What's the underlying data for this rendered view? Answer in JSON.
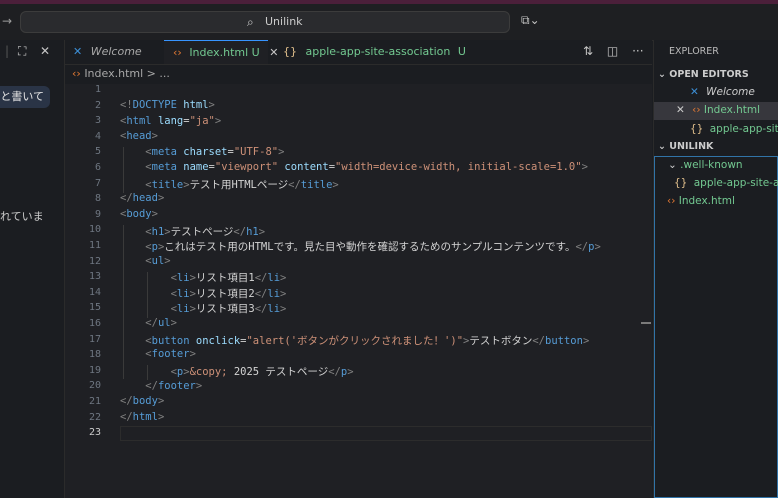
{
  "titlebar": {
    "search_label": "Unilink",
    "search_icon": "search-icon",
    "copilot_icon": "copilot-icon"
  },
  "left_panel": {
    "bubble_text": "と書いて",
    "text2": "れていま"
  },
  "tabs": [
    {
      "label": "Welcome",
      "icon": "vscode-icon",
      "active": false,
      "status": ""
    },
    {
      "label": "Index.html",
      "icon": "html-icon",
      "active": true,
      "status": "U"
    },
    {
      "label": "apple-app-site-association",
      "icon": "json-icon",
      "active": false,
      "status": "U"
    }
  ],
  "breadcrumb": {
    "file": "Index.html",
    "rest": "> ..."
  },
  "editor": {
    "line_numbers": [
      "1",
      "2",
      "3",
      "4",
      "5",
      "6",
      "7",
      "8",
      "9",
      "10",
      "11",
      "12",
      "13",
      "14",
      "15",
      "16",
      "17",
      "18",
      "19",
      "20",
      "21",
      "22",
      "23"
    ],
    "current_line": 23
  },
  "explorer": {
    "title": "EXPLORER",
    "open_editors_header": "OPEN EDITORS",
    "open_editors": [
      {
        "label": "Welcome",
        "icon": "vscode-icon"
      },
      {
        "label": "Index.html",
        "icon": "html-icon",
        "selected": true
      },
      {
        "label": "apple-app-site-",
        "icon": "json-icon"
      }
    ],
    "workspace_header": "UNILINK",
    "tree": [
      {
        "label": ".well-known",
        "type": "folder"
      },
      {
        "label": "apple-app-site-asso",
        "type": "json"
      },
      {
        "label": "Index.html",
        "type": "html"
      }
    ]
  },
  "colors": {
    "accent": "#3794ff",
    "untracked": "#73c991",
    "html_icon": "#e37933"
  }
}
